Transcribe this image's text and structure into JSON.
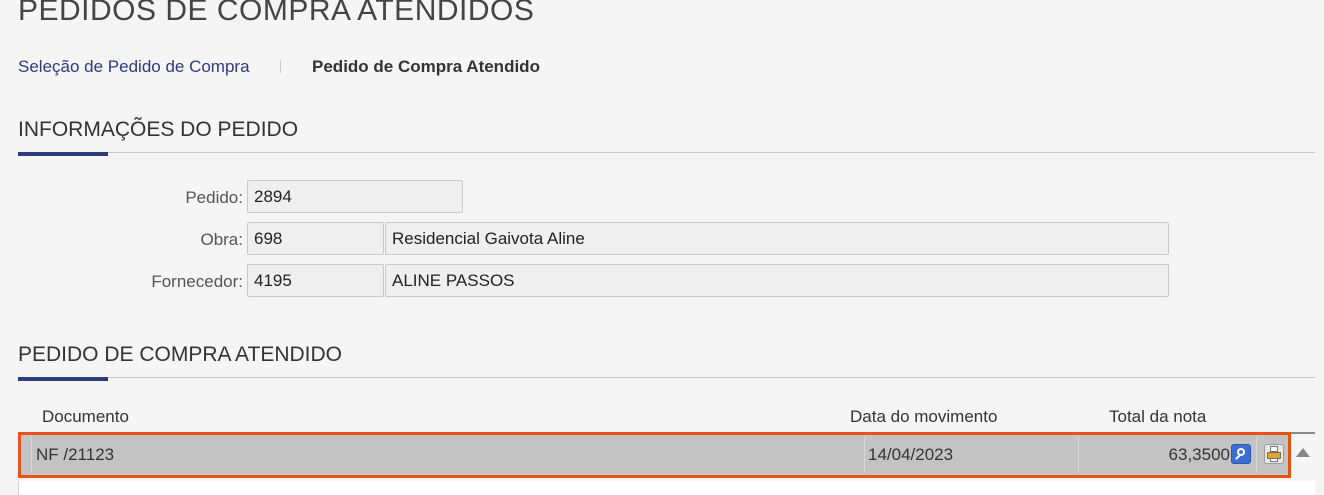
{
  "page": {
    "title": "PEDIDOS DE COMPRA ATENDIDOS"
  },
  "breadcrumb": {
    "link": "Seleção de Pedido de Compra",
    "current": "Pedido de Compra Atendido"
  },
  "info_section": {
    "title": "INFORMAÇÕES DO PEDIDO",
    "pedido_label": "Pedido:",
    "pedido_value": "2894",
    "obra_label": "Obra:",
    "obra_code": "698",
    "obra_name": "Residencial Gaivota Aline",
    "fornecedor_label": "Fornecedor:",
    "fornecedor_code": "4195",
    "fornecedor_name": "ALINE PASSOS"
  },
  "grid_section": {
    "title": "PEDIDO DE COMPRA ATENDIDO",
    "columns": [
      "Documento",
      "Data do movimento",
      "Total da nota"
    ],
    "rows": [
      {
        "documento": "NF /21123",
        "data": "14/04/2023",
        "total": "63,3500"
      }
    ]
  },
  "colors": {
    "accent": "#2f3b7a",
    "row_highlight": "#e8521a",
    "row_bg": "#c3c3c3"
  },
  "icons": [
    "view-icon",
    "print-icon",
    "scroll-up-icon"
  ]
}
